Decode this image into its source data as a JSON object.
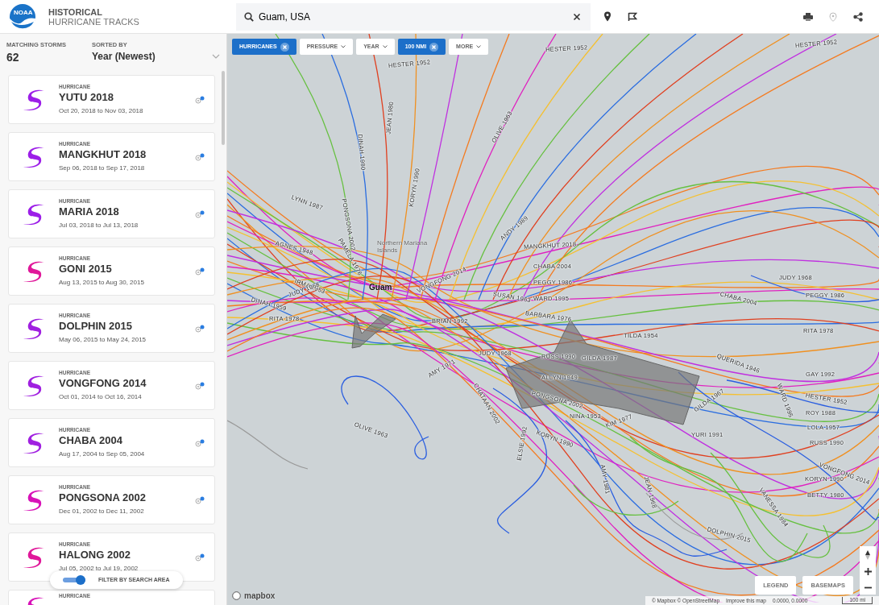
{
  "header": {
    "logo_text": "NOAA",
    "title": "HISTORICAL",
    "subtitle": "HURRICANE TRACKS",
    "search": {
      "value": "Guam, USA"
    }
  },
  "sidebar": {
    "count_label": "MATCHING STORMS",
    "count": "62",
    "sort_label": "SORTED BY",
    "sort_value": "Year (Newest)",
    "storms": [
      {
        "category": "HURRICANE",
        "name": "YUTU 2018",
        "dates": "Oct 20, 2018 to Nov 03, 2018",
        "color": "#9c1ee8"
      },
      {
        "category": "HURRICANE",
        "name": "MANGKHUT 2018",
        "dates": "Sep 06, 2018 to Sep 17, 2018",
        "color": "#9c1ee8"
      },
      {
        "category": "HURRICANE",
        "name": "MARIA 2018",
        "dates": "Jul 03, 2018 to Jul 13, 2018",
        "color": "#9c1ee8"
      },
      {
        "category": "HURRICANE",
        "name": "GONI 2015",
        "dates": "Aug 13, 2015 to Aug 30, 2015",
        "color": "#e0189a"
      },
      {
        "category": "HURRICANE",
        "name": "DOLPHIN 2015",
        "dates": "May 06, 2015 to May 24, 2015",
        "color": "#a020e0"
      },
      {
        "category": "HURRICANE",
        "name": "VONGFONG 2014",
        "dates": "Oct 01, 2014 to Oct 16, 2014",
        "color": "#a020e0"
      },
      {
        "category": "HURRICANE",
        "name": "CHABA 2004",
        "dates": "Aug 17, 2004 to Sep 05, 2004",
        "color": "#a020e0"
      },
      {
        "category": "HURRICANE",
        "name": "PONGSONA 2002",
        "dates": "Dec 01, 2002 to Dec 11, 2002",
        "color": "#d812b8"
      },
      {
        "category": "HURRICANE",
        "name": "HALONG 2002",
        "dates": "Jul 05, 2002 to Jul 19, 2002",
        "color": "#e0189a"
      },
      {
        "category": "HURRICANE",
        "color": "#d812b8"
      }
    ],
    "area_filter": {
      "label": "FILTER BY SEARCH AREA",
      "on": true
    }
  },
  "filters": [
    {
      "label": "HURRICANES",
      "active": true
    },
    {
      "label": "PRESSURE",
      "active": false
    },
    {
      "label": "YEAR",
      "active": false
    },
    {
      "label": "100 NMI",
      "active": true
    },
    {
      "label": "MORE",
      "active": false
    }
  ],
  "map": {
    "place_labels": [
      "Northern Mariana Islands",
      "Guam"
    ],
    "track_labels": [
      "HESTER 1952",
      "HESTER 1952",
      "HESTER 1952",
      "DINAH 1980",
      "JEAN 1980",
      "OLIVE 1963",
      "KORYN 1990",
      "PONGSONA 2002",
      "LYNN 1987",
      "PAMELA 1976",
      "AGNES 1948",
      "ANDY 1989",
      "IRMA 1953",
      "JUDY 1968",
      "DINAH 1959",
      "RITA 1978",
      "MANGKHUT 2018",
      "CHABA 2004",
      "PEGGY 1986",
      "WARD 1995",
      "BARBARA 1976",
      "VONGFONG 2014",
      "SUSAN 1963",
      "BRIAN 1992",
      "JUDY 1968",
      "AMY 1971",
      "CHATAAN 2002",
      "RUSS 1990",
      "GILDA 1987",
      "TILDA 1954",
      "ALLYN 1949",
      "PONGSONA 2002",
      "NINA 1953",
      "KIM 1977",
      "KORYN 1990",
      "ELSIE 1992",
      "AMY 1981",
      "JEAN 1968",
      "OLIVE 1963",
      "GILDA 1967",
      "YURI 1991",
      "QUERIDA 1946",
      "CHABA 2004",
      "JUDY 1968",
      "PEGGY 1986",
      "RITA 1978",
      "GAY 1992",
      "HESTER 1952",
      "WARD 1995",
      "ROY 1988",
      "LOLA 1957",
      "RUSS 1990",
      "VONGFONG 2014",
      "KORYN 1990",
      "BETTY 1980",
      "VANESSA 1984",
      "DOLPHIN 2015"
    ],
    "buttons": [
      "LEGEND",
      "BASEMAPS"
    ],
    "mapbox_logo": "mapbox",
    "attribution": "© Mapbox © OpenStreetMap",
    "improve_link": "Improve this map",
    "coordinates": "0.0000, 0.0000",
    "scale": "100 mi"
  }
}
